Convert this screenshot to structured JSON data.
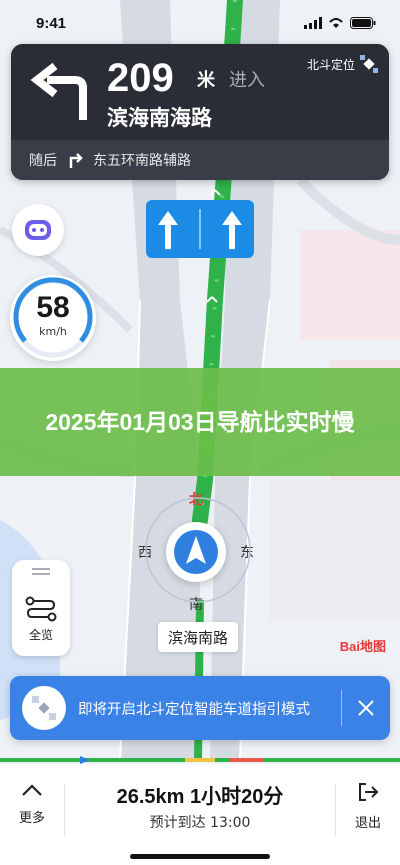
{
  "status_bar": {
    "time": "9:41"
  },
  "nav": {
    "distance": "209",
    "distance_unit": "米",
    "action": "进入",
    "road": "滨海南海路",
    "positioning": "北斗定位",
    "next_prefix": "随后",
    "next_road": "东五环南路辅路"
  },
  "speed": {
    "value": "58",
    "unit": "km/h"
  },
  "headline": "2025年01月03日导航比实时慢",
  "compass": {
    "north": "北",
    "south": "南",
    "east": "东",
    "west": "西"
  },
  "current_road": "滨海南路",
  "overview": {
    "label": "全览"
  },
  "map_logo": "Bai地图",
  "beidou_banner": {
    "text": "即将开启北斗定位智能车道指引模式"
  },
  "trip": {
    "summary": "26.5km 1小时20分",
    "eta": "预计到达 13:00"
  },
  "bottom": {
    "more_label": "更多",
    "exit_label": "退出"
  },
  "colors": {
    "route_green": "#2fb24a",
    "lane_blue": "#1b8be6",
    "banner_blue": "#3b82e6",
    "headline_green": "#6cbe4a"
  }
}
